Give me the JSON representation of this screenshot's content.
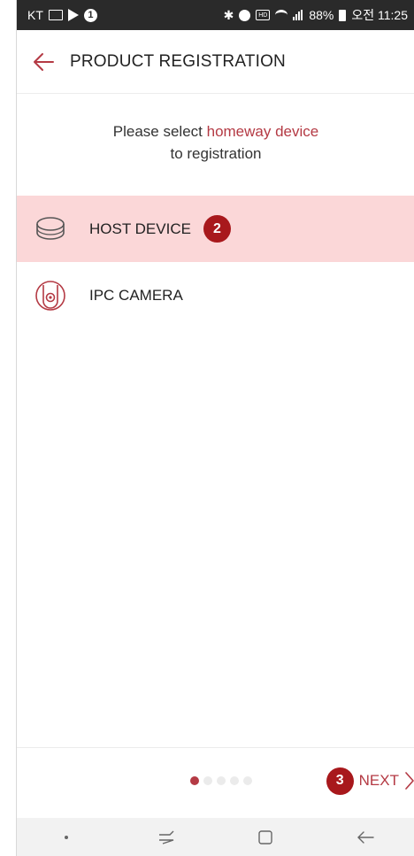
{
  "status_bar": {
    "carrier": "KT",
    "battery": "88%",
    "time": "오전 11:25",
    "icons": [
      "image-icon",
      "play-icon",
      "notification-1-icon",
      "bluetooth-icon",
      "alarm-icon",
      "hd-icon",
      "wifi-icon",
      "signal-icon",
      "battery-icon"
    ]
  },
  "header": {
    "title": "PRODUCT REGISTRATION",
    "back_icon": "arrow-left-icon"
  },
  "instruction": {
    "line1_prefix": "Please select ",
    "line1_highlight": "homeway device",
    "line2": "to registration"
  },
  "devices": [
    {
      "label": "HOST DEVICE",
      "icon": "host-device-icon",
      "selected": true,
      "badge": "2"
    },
    {
      "label": "IPC CAMERA",
      "icon": "ipc-camera-icon",
      "selected": false
    }
  ],
  "pagination": {
    "total": 5,
    "current": 1
  },
  "next": {
    "label": "NEXT",
    "badge": "3",
    "icon": "chevron-right-icon"
  },
  "nav_bar": {
    "icons": [
      "dot-icon",
      "recent-apps-icon",
      "home-icon",
      "back-icon"
    ]
  },
  "colors": {
    "accent": "#b43a44",
    "selected_bg": "#fbd7d8",
    "badge": "#a8181c",
    "statusbar": "#2a2a2a"
  }
}
